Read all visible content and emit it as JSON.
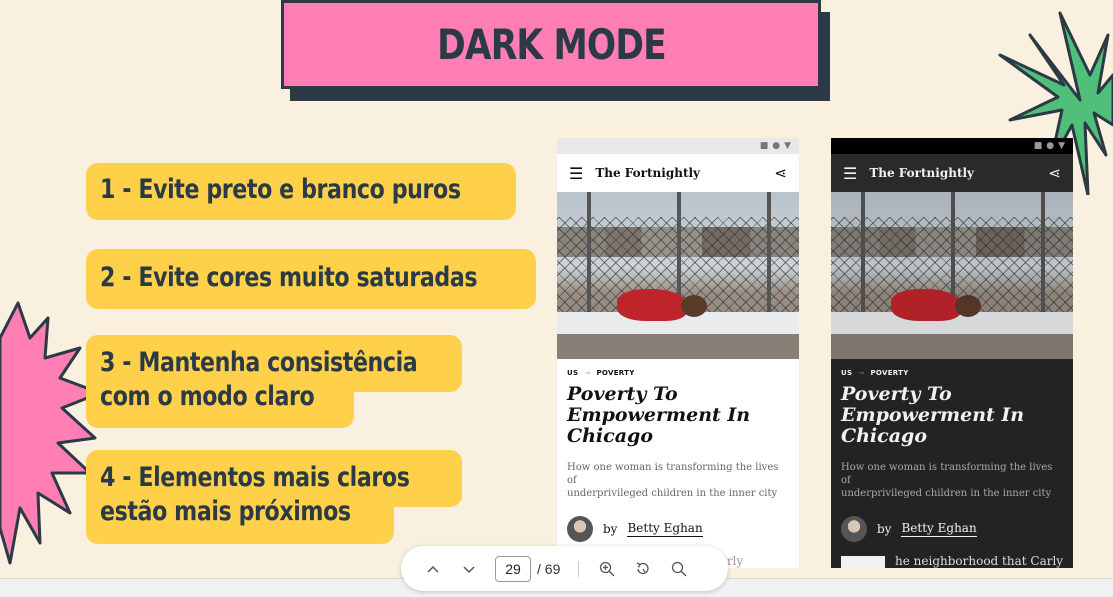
{
  "slide": {
    "title": "DARK MODE",
    "tips": [
      {
        "lines": [
          "1 - Evite preto e branco puros"
        ]
      },
      {
        "lines": [
          "2 - Evite cores muito saturadas"
        ]
      },
      {
        "lines": [
          "3 - Mantenha consistência",
          "com o modo claro"
        ]
      },
      {
        "lines": [
          "4 - Elementos mais claros",
          "estão mais próximos"
        ]
      }
    ],
    "phones": {
      "brand": "The Fortnightly",
      "tag1": "US",
      "tag_sep": "→",
      "tag2": "POVERTY",
      "headline_lines": [
        "Poverty To",
        "Empowerment In",
        "Chicago"
      ],
      "dek_lines": [
        "How one woman is transforming the lives of",
        "underprivileged children in the inner city"
      ],
      "byline_prefix": "by",
      "author": "Betty Eghan",
      "light_next_text": "hat Carly",
      "dark_next_text": "he neighborhood that Carly"
    },
    "colors": {
      "background": "#f9f0df",
      "title_fill": "#ff7eb3",
      "tip_fill": "#ffd14a",
      "ink": "#2b3a45",
      "green_deco": "#4fbf7a",
      "pink_deco": "#ff7eb3"
    }
  },
  "viewer": {
    "page_current": "29",
    "page_total": "/ 69",
    "icons": [
      "chevron-up-icon",
      "chevron-down-icon",
      "zoom-in-icon",
      "rotate-icon",
      "search-icon"
    ]
  }
}
